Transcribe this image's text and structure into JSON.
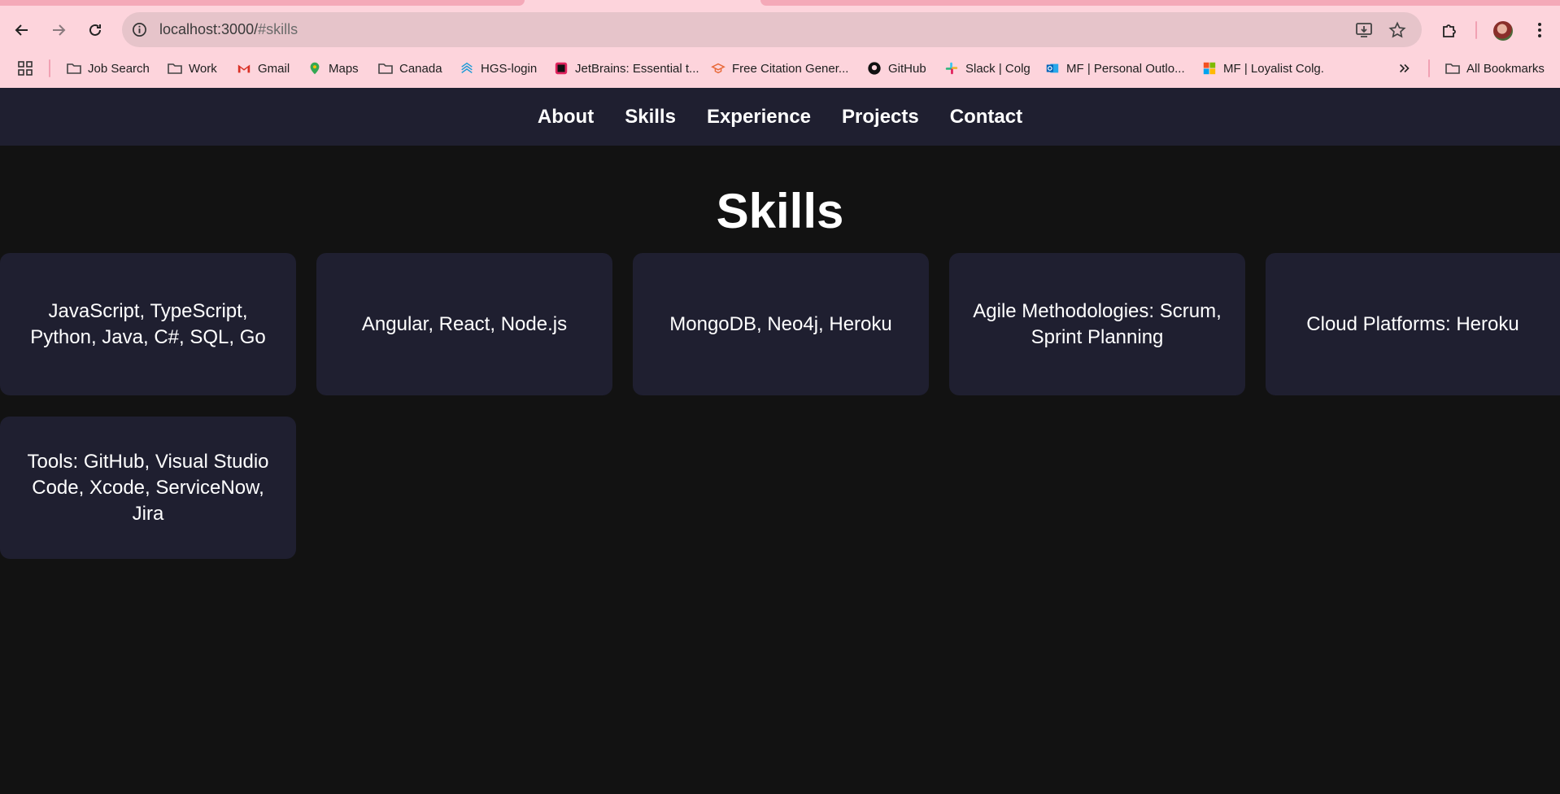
{
  "browser": {
    "url_host": "localhost:3000/",
    "url_path": "#skills",
    "colors": {
      "chrome": "#fdd4dc",
      "omnibox": "#e6c4ca"
    },
    "bookmarks": [
      {
        "label": "Job Search",
        "icon": "folder-icon"
      },
      {
        "label": "Work",
        "icon": "folder-icon"
      },
      {
        "label": "Gmail",
        "icon": "gmail-icon"
      },
      {
        "label": "Maps",
        "icon": "maps-icon"
      },
      {
        "label": "Canada",
        "icon": "folder-icon"
      },
      {
        "label": "HGS-login",
        "icon": "hgs-icon"
      },
      {
        "label": "JetBrains: Essential t...",
        "icon": "jetbrains-icon"
      },
      {
        "label": "Free Citation Gener...",
        "icon": "citation-icon"
      },
      {
        "label": "GitHub",
        "icon": "github-icon"
      },
      {
        "label": "Slack | Colg",
        "icon": "slack-icon"
      },
      {
        "label": "MF | Personal Outlo...",
        "icon": "outlook-icon"
      },
      {
        "label": "MF | Loyalist Colg.",
        "icon": "microsoft-icon"
      }
    ],
    "all_bookmarks_label": "All Bookmarks"
  },
  "nav": {
    "items": [
      "About",
      "Skills",
      "Experience",
      "Projects",
      "Contact"
    ]
  },
  "skills": {
    "title": "Skills",
    "cards": [
      "JavaScript, TypeScript, Python, Java, C#, SQL, Go",
      "Angular, React, Node.js",
      "MongoDB, Neo4j, Heroku",
      "Agile Methodologies: Scrum, Sprint Planning",
      "Cloud Platforms: Heroku",
      "Tools: GitHub, Visual Studio Code, Xcode, ServiceNow, Jira"
    ]
  },
  "colors": {
    "page_bg": "#121212",
    "card_bg": "#1f1f30",
    "text": "#ffffff"
  }
}
